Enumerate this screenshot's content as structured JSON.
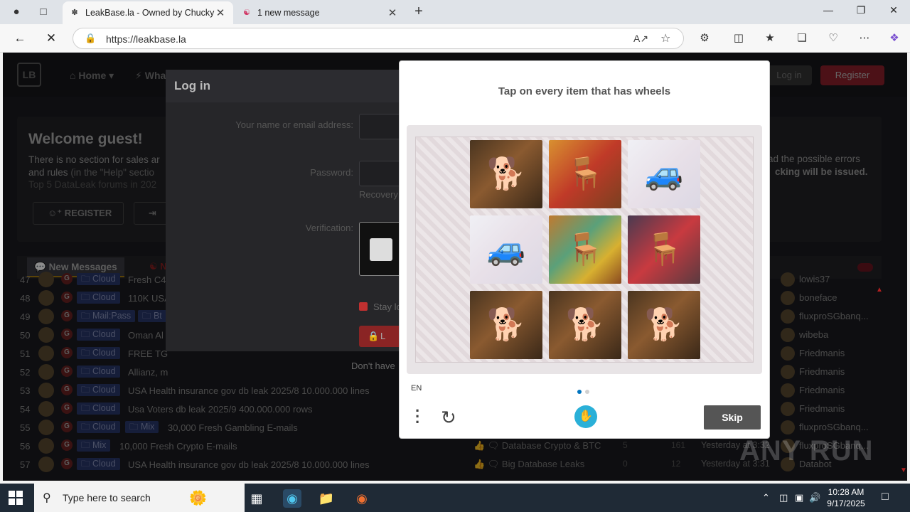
{
  "browser": {
    "tabs": [
      {
        "title": "LeakBase.la - Owned by Chucky",
        "active": true
      },
      {
        "title": "1 new message",
        "active": false
      }
    ],
    "url": "https://leakbase.la"
  },
  "site": {
    "logo": "LB",
    "nav": {
      "home": "Home",
      "whats_new": "Wha"
    },
    "login_label": "Log in",
    "register_label": "Register",
    "welcome": {
      "title": "Welcome guest!",
      "line1": "There is no section for sales ar",
      "line2_a": "and rules",
      "line2_b": "(in the \"Help\" sectio",
      "line3": "Top 5 DataLeak forums in 202",
      "right1": "ad the possible errors",
      "right2": "cking will be issued.",
      "register_btn": "REGISTER"
    },
    "tabs": {
      "new_messages": "New Messages",
      "second": "N"
    },
    "threads": [
      {
        "num": "47",
        "tags": [
          "Cloud"
        ],
        "title": "Fresh C4",
        "forum": "",
        "replies": "",
        "views": "",
        "date": "",
        "user": "lowis37"
      },
      {
        "num": "48",
        "tags": [
          "Cloud"
        ],
        "title": "110K USA",
        "forum": "",
        "replies": "",
        "views": "",
        "date": "",
        "user": "boneface"
      },
      {
        "num": "49",
        "tags": [
          "Mail:Pass",
          "Bt"
        ],
        "title": "",
        "forum": "",
        "replies": "",
        "views": "",
        "date": "",
        "user": "fluxproSGbanq..."
      },
      {
        "num": "50",
        "tags": [
          "Cloud"
        ],
        "title": "Oman Al",
        "forum": "",
        "replies": "",
        "views": "",
        "date": "",
        "user": "wibeba"
      },
      {
        "num": "51",
        "tags": [
          "Cloud"
        ],
        "title": "FREE TG",
        "forum": "",
        "replies": "",
        "views": "",
        "date": "",
        "user": "Friedmanis"
      },
      {
        "num": "52",
        "tags": [
          "Cloud"
        ],
        "title": "Allianz, m",
        "forum": "",
        "replies": "",
        "views": "",
        "date": "",
        "user": "Friedmanis"
      },
      {
        "num": "53",
        "tags": [
          "Cloud"
        ],
        "title": "USA Health insurance gov db leak 2025/8 10.000.000 lines",
        "forum": "",
        "replies": "",
        "views": "",
        "date": "",
        "user": "Friedmanis"
      },
      {
        "num": "54",
        "tags": [
          "Cloud"
        ],
        "title": "Usa Voters db leak 2025/9 400.000.000 rows",
        "forum": "",
        "replies": "",
        "views": "",
        "date": "",
        "user": "Friedmanis"
      },
      {
        "num": "55",
        "tags": [
          "Cloud",
          "Mix"
        ],
        "title": "30,000 Fresh Gambling E-mails",
        "forum": "",
        "replies": "",
        "views": "",
        "date": "",
        "user": "fluxproSGbanq..."
      },
      {
        "num": "56",
        "tags": [
          "Mix"
        ],
        "title": "10,000 Fresh Crypto E-mails",
        "forum": "Database Crypto & BTC",
        "replies": "5",
        "views": "161",
        "date": "Yesterday at 3:32",
        "user": "fluxproSGbanq..."
      },
      {
        "num": "57",
        "tags": [
          "Cloud"
        ],
        "title": "USA Health insurance gov db leak 2025/8 10.000.000 lines",
        "forum": "Big Database Leaks",
        "replies": "0",
        "views": "12",
        "date": "Yesterday at 3:31",
        "user": "Databot"
      }
    ]
  },
  "login_modal": {
    "title": "Log in",
    "name_label": "Your name or email address:",
    "password_label": "Password:",
    "recovery": "Recovery",
    "verification_label": "Verification:",
    "stay_logged": "Stay lo",
    "login_btn": "L",
    "dont_have": "Don't have"
  },
  "captcha": {
    "prompt": "Tap on every item that has wheels",
    "lang": "EN",
    "skip_label": "Skip",
    "tiles": [
      "dog",
      "chair",
      "truck",
      "truck",
      "chair",
      "chair",
      "dog",
      "dog",
      "dog"
    ],
    "colors": {
      "dot_active": "#0074bf",
      "dot_inactive": "#d0d0d0",
      "logo": "#2ab0d8"
    }
  },
  "taskbar": {
    "search_placeholder": "Type here to search",
    "time": "10:28 AM",
    "date": "9/17/2025"
  },
  "watermark": "ANY RUN"
}
